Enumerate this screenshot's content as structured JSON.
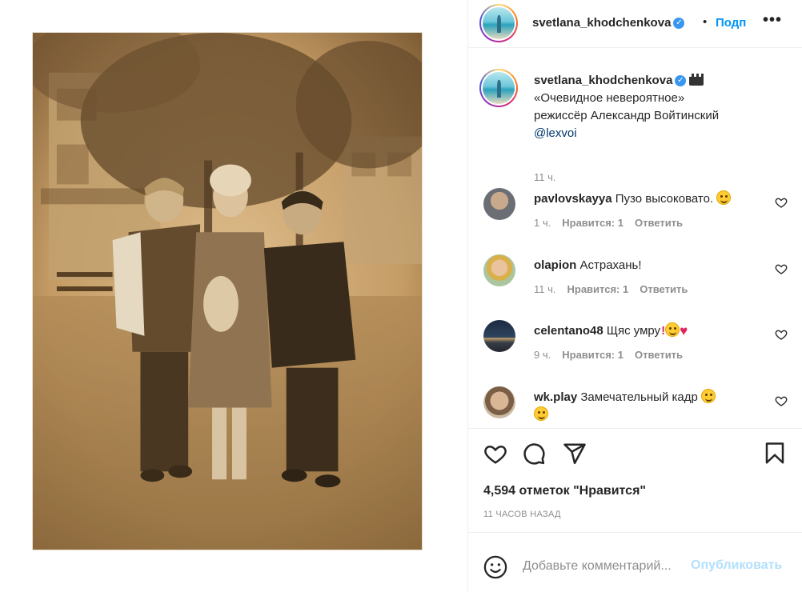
{
  "post": {
    "username": "svetlana_khodchenkova",
    "follow_label": "Подп",
    "more_label": "•••",
    "separator": "•",
    "verified_glyph": "✓"
  },
  "caption": {
    "username": "svetlana_khodchenkova",
    "line1": "«Очевидное невероятное»",
    "line2": "режиссёр Александр Войтинский",
    "mention": "@lexvoi",
    "time": "11 ч."
  },
  "comments": [
    {
      "username": "pavlovskayya",
      "text": "Пузо высоковато.",
      "time": "1 ч.",
      "likes": "Нравится: 1",
      "reply": "Ответить"
    },
    {
      "username": "olapion",
      "text": "Астрахань!",
      "time": "11 ч.",
      "likes": "Нравится: 1",
      "reply": "Ответить"
    },
    {
      "username": "celentano48",
      "text": "Щяс умру",
      "time": "9 ч.",
      "likes": "Нравится: 1",
      "reply": "Ответить"
    },
    {
      "username": "wk.play",
      "text": "Замечательный кадр",
      "time": "",
      "likes": "",
      "reply": ""
    }
  ],
  "actions": {
    "likes_count": "4,594 отметок \"Нравится\"",
    "post_time": "11 ЧАСОВ НАЗАД"
  },
  "add_comment": {
    "placeholder": "Добавьте комментарий...",
    "publish_label": "Опубликовать"
  },
  "icons": {
    "like": "heart-icon",
    "comment": "comment-icon",
    "share": "share-icon",
    "save": "bookmark-icon",
    "emoji": "smile-icon"
  },
  "colors": {
    "accent": "#0095f6",
    "publish_disabled": "#b2dffc",
    "secondary_text": "#8e8e8e",
    "mention": "#00376b"
  }
}
